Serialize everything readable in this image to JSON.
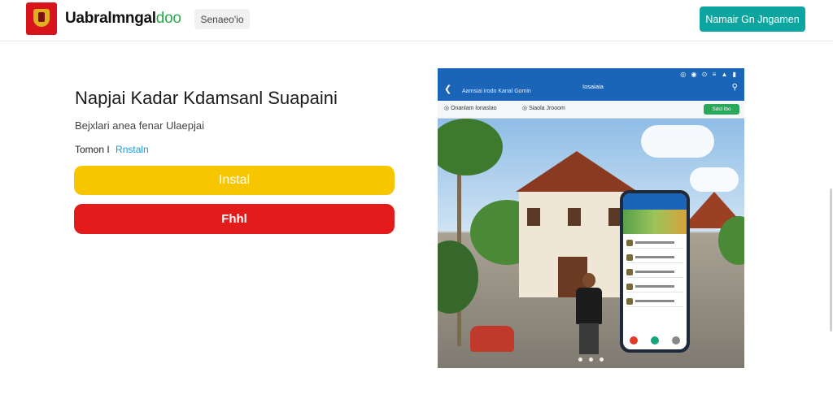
{
  "header": {
    "brand_main": "Uabralmngal",
    "brand_suffix": "doo",
    "nav_button": "Senaeo'io",
    "cta_button": "Namair Gn Jngamen"
  },
  "hero": {
    "title": "Napjai Kadar Kdamsanl Suapaini",
    "subtitle": "Bejxlari anea fenar Ulaepjai",
    "meta_label": "Tomon I",
    "meta_link": "Rnstaln",
    "install_button": "Instal",
    "secondary_button": "Fhhl"
  },
  "screenshot": {
    "app_name": "Aamsiai irodo Kanal Gomin",
    "app_title": "Iosaiaia",
    "filter_1": "Onanlam lonaslao",
    "filter_2": "Siaola Jrooom",
    "badge": "Sdcl lbo",
    "status_icons": "◎ ◉ ⊙ ≡ ▲ ▮"
  },
  "colors": {
    "accent": "#0da59f",
    "install": "#f7c600",
    "danger": "#e31b1b",
    "appbar": "#1a65b8",
    "link": "#1a9bd6"
  },
  "icons": {
    "logo": "crest-logo",
    "back": "arrow-left-icon",
    "search": "search-icon"
  }
}
